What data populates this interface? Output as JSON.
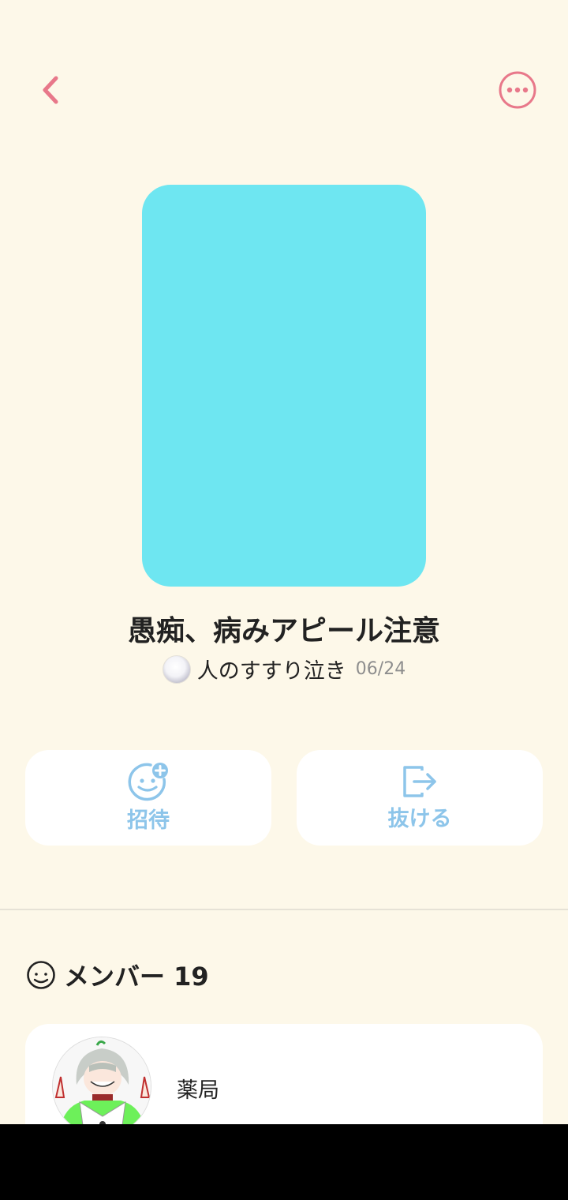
{
  "header": {
    "back_icon": "chevron-left-icon",
    "more_icon": "more-horizontal-icon",
    "accent_color": "#e8788a"
  },
  "cover": {
    "color": "#6ee6f1"
  },
  "group": {
    "title": "愚痴、病みアピール注意",
    "owner_name": "人のすすり泣き",
    "date": "06/24"
  },
  "actions": {
    "invite_label": "招待",
    "invite_icon": "smiley-plus-icon",
    "leave_label": "抜ける",
    "leave_icon": "exit-icon",
    "color": "#8dc5ea"
  },
  "members": {
    "title": "メンバー 19",
    "icon": "smiley-face-icon",
    "list": [
      {
        "name": "薬局"
      }
    ]
  }
}
